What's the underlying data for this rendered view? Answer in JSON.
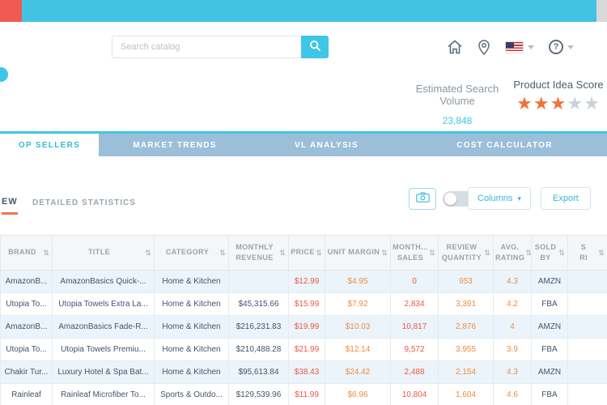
{
  "toolbar": {
    "search_placeholder": "Search catalog"
  },
  "icons": {
    "sort": "⇅",
    "caret": "▾",
    "question_mark": "?",
    "star": "★"
  },
  "stats": {
    "search_volume_label": "Estimated Search Volume",
    "search_volume_value": "23,848",
    "idea_score_label": "Product Idea Score",
    "stars_filled": 3,
    "stars_total": 5
  },
  "tabs": [
    {
      "label": "OP SELLERS",
      "active": true
    },
    {
      "label": "MARKET TRENDS",
      "active": false
    },
    {
      "label": "VL ANALYSIS",
      "active": false
    },
    {
      "label": "COST CALCULATOR",
      "active": false
    }
  ],
  "subnav": {
    "items": [
      {
        "label": "EW",
        "active": true
      },
      {
        "label": "DETAILED STATISTICS",
        "active": false
      }
    ],
    "columns_button": "Columns",
    "export_button": "Export"
  },
  "table": {
    "headers": [
      {
        "label": "BRAND"
      },
      {
        "label": "TITLE"
      },
      {
        "label": "CATEGORY"
      },
      {
        "label": "MONTHLY REVENUE"
      },
      {
        "label": "PRICE"
      },
      {
        "label": "UNIT MARGIN"
      },
      {
        "label": "MONTH... SALES"
      },
      {
        "label": "REVIEW QUANTITY"
      },
      {
        "label": "AVG. RATING"
      },
      {
        "label": "SOLD BY"
      },
      {
        "label": "S\nRI"
      }
    ],
    "rows": [
      [
        "AmazonB...",
        "AmazonBasics Quick-...",
        "Home & Kitchen",
        "",
        "$12.99",
        "$4.95",
        "0",
        "953",
        "4.3",
        "AMZN",
        ""
      ],
      [
        "Utopia To...",
        "Utopia Towels Extra La...",
        "Home & Kitchen",
        "$45,315.66",
        "$15.99",
        "$7.92",
        "2,834",
        "3,391",
        "4.2",
        "FBA",
        ""
      ],
      [
        "AmazonB...",
        "AmazonBasics Fade-R...",
        "Home & Kitchen",
        "$216,231.83",
        "$19.99",
        "$10.03",
        "10,817",
        "2,876",
        "4",
        "AMZN",
        ""
      ],
      [
        "Utopia To...",
        "Utopia Towels Premiu...",
        "Home & Kitchen",
        "$210,488.28",
        "$21.99",
        "$12.14",
        "9,572",
        "3,955",
        "3.9",
        "FBA",
        ""
      ],
      [
        "Chakir Tur...",
        "Luxury Hotel & Spa Bat...",
        "Home & Kitchen",
        "$95,613.84",
        "$38.43",
        "$24.42",
        "2,488",
        "2,154",
        "4.3",
        "AMZN",
        ""
      ],
      [
        "Rainleaf",
        "Rainleaf Microfiber To...",
        "Sports & Outdo...",
        "$129,539.96",
        "$11.99",
        "$6.96",
        "10,804",
        "1,604",
        "4.6",
        "FBA",
        ""
      ]
    ]
  },
  "colors": {
    "accent_teal": "#3ec6e6",
    "tab_bar_blue": "#9cbfd9",
    "logo_red": "#f05a50",
    "metric_red": "#ee5743",
    "metric_orange": "#f08a3e",
    "star_orange": "#f2703a",
    "row_stripe": "#ebf4fa"
  }
}
